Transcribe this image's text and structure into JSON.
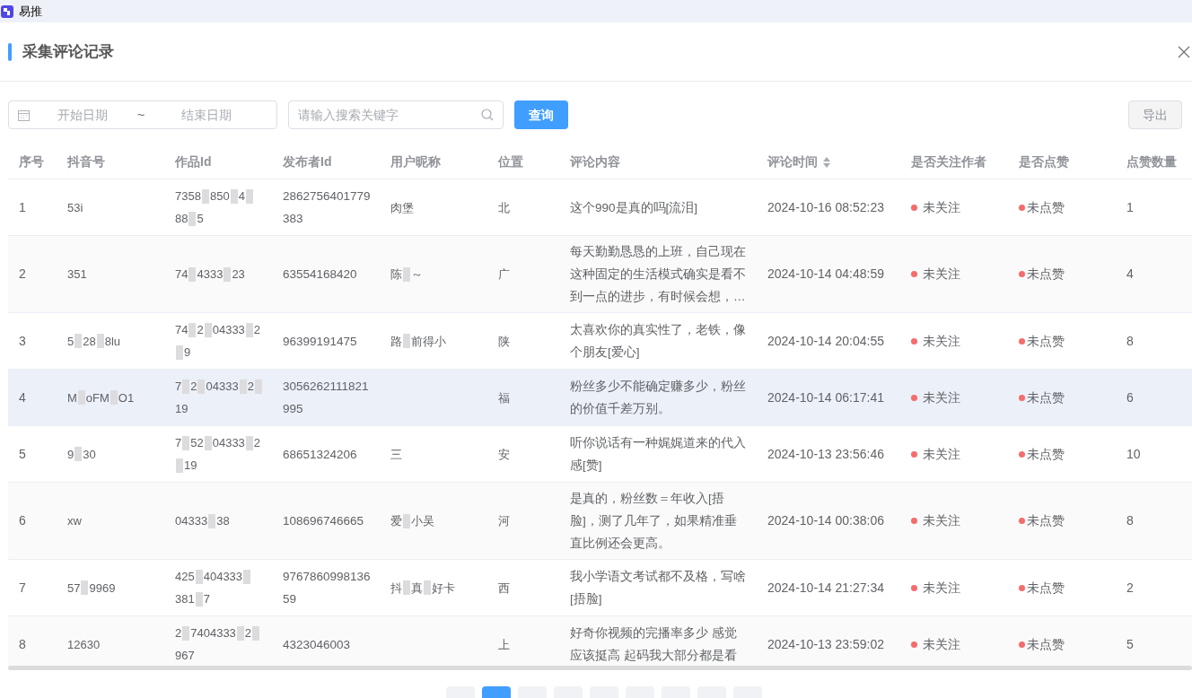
{
  "app": {
    "name": "易推"
  },
  "dialog": {
    "title": "采集评论记录"
  },
  "filters": {
    "start_placeholder": "开始日期",
    "separator": "~",
    "end_placeholder": "结束日期",
    "search_placeholder": "请输入搜索关键字",
    "query_button": "查询",
    "export_button": "导出"
  },
  "table": {
    "columns": [
      {
        "label": "序号"
      },
      {
        "label": "抖音号"
      },
      {
        "label": "作品Id"
      },
      {
        "label": "发布者Id"
      },
      {
        "label": "用户昵称"
      },
      {
        "label": "位置"
      },
      {
        "label": "评论内容"
      },
      {
        "label": "评论时间",
        "sortable": true
      },
      {
        "label": "是否关注作者"
      },
      {
        "label": "是否点赞"
      },
      {
        "label": "点赞数量"
      }
    ],
    "rows": [
      {
        "index": "1",
        "douyin": [
          "53i"
        ],
        "work": [
          "7358",
          "850",
          "4",
          "88",
          "5"
        ],
        "publisher": "2862756401779383",
        "nick": [
          "肉堡"
        ],
        "location": [
          "北"
        ],
        "comment": "这个990是真的吗[流泪]",
        "time": "2024-10-16 08:52:23",
        "follow": {
          "on": false,
          "label": "未关注"
        },
        "like": {
          "on": false,
          "label": "未点赞"
        },
        "likes": "1",
        "hovered": false
      },
      {
        "index": "2",
        "douyin": [
          "351"
        ],
        "work": [
          "74",
          "4333",
          "23"
        ],
        "publisher": "63554168420",
        "nick": [
          "陈",
          "～"
        ],
        "location": [
          "广"
        ],
        "comment": "每天勤勤恳恳的上班，自己现在这种固定的生活模式确实是看不到一点的进步，有时候会想，…",
        "time": "2024-10-14 04:48:59",
        "follow": {
          "on": false,
          "label": "未关注"
        },
        "like": {
          "on": false,
          "label": "未点赞"
        },
        "likes": "4",
        "hovered": false
      },
      {
        "index": "3",
        "douyin": [
          "5",
          "28",
          "8lu"
        ],
        "work": [
          "74",
          "2",
          "04333",
          "2",
          "9"
        ],
        "publisher": "96399191475",
        "nick": [
          "路",
          "前得小"
        ],
        "location": [
          "陕"
        ],
        "comment": "太喜欢你的真实性了，老铁，像个朋友[爱心]",
        "time": "2024-10-14 20:04:55",
        "follow": {
          "on": false,
          "label": "未关注"
        },
        "like": {
          "on": false,
          "label": "未点赞"
        },
        "likes": "8",
        "hovered": false
      },
      {
        "index": "4",
        "douyin": [
          "M",
          "oFM",
          "O1"
        ],
        "work": [
          "7",
          "2",
          "04333",
          "2",
          "19"
        ],
        "publisher": "3056262111821995",
        "location": [
          "福"
        ],
        "comment": "粉丝多少不能确定赚多少，粉丝的价值千差万别。",
        "time": "2024-10-14 06:17:41",
        "follow": {
          "on": false,
          "label": "未关注"
        },
        "like": {
          "on": false,
          "label": "未点赞"
        },
        "likes": "6",
        "hovered": true
      },
      {
        "index": "5",
        "douyin": [
          "9",
          "30"
        ],
        "work": [
          "7",
          "52",
          "04333",
          "2",
          "19"
        ],
        "publisher": "68651324206",
        "nick": [
          "三"
        ],
        "location": [
          "安"
        ],
        "comment": "听你说话有一种娓娓道来的代入感[赞]",
        "time": "2024-10-13 23:56:46",
        "follow": {
          "on": false,
          "label": "未关注"
        },
        "like": {
          "on": false,
          "label": "未点赞"
        },
        "likes": "10",
        "hovered": false
      },
      {
        "index": "6",
        "douyin": [
          "xw"
        ],
        "work": [
          "04333",
          "38"
        ],
        "publisher": "108696746665",
        "nick": [
          "爱",
          "小吴"
        ],
        "location": [
          "河"
        ],
        "comment": "是真的，粉丝数＝年收入[捂脸]，测了几年了，如果精准垂直比例还会更高。",
        "time": "2024-10-14 00:38:06",
        "follow": {
          "on": false,
          "label": "未关注"
        },
        "like": {
          "on": false,
          "label": "未点赞"
        },
        "likes": "8",
        "hovered": false
      },
      {
        "index": "7",
        "douyin": [
          "57",
          "9969"
        ],
        "work": [
          "425",
          "404333",
          "381",
          "7"
        ],
        "publisher": "976786099813659",
        "nick": [
          "抖",
          "真",
          "好卡"
        ],
        "location": [
          "西"
        ],
        "comment": "我小学语文考试都不及格，写啥[捂脸]",
        "time": "2024-10-14 21:27:34",
        "follow": {
          "on": false,
          "label": "未关注"
        },
        "like": {
          "on": false,
          "label": "未点赞"
        },
        "likes": "2",
        "hovered": false
      },
      {
        "index": "8",
        "douyin": [
          "12630"
        ],
        "work": [
          "2",
          "7404333",
          "2",
          "967"
        ],
        "publisher": "4323046003",
        "location": [
          "上"
        ],
        "comment": "好奇你视频的完播率多少 感觉应该挺高 起码我大部分都是看",
        "time": "2024-10-13 23:59:02",
        "follow": {
          "on": false,
          "label": "未关注"
        },
        "like": {
          "on": false,
          "label": "未点赞"
        },
        "likes": "5",
        "hovered": false
      }
    ]
  },
  "pagination": [
    {
      "selected": false
    },
    {
      "selected": true
    },
    {
      "selected": false
    },
    {
      "selected": false
    },
    {
      "selected": false
    },
    {
      "selected": false
    },
    {
      "selected": false
    },
    {
      "selected": false
    },
    {
      "selected": false
    }
  ]
}
